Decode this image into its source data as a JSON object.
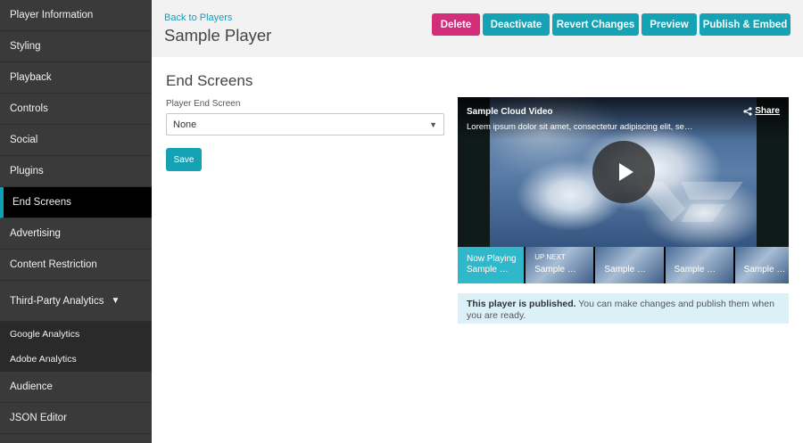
{
  "sidebar": {
    "items": [
      {
        "label": "Player Information"
      },
      {
        "label": "Styling"
      },
      {
        "label": "Playback"
      },
      {
        "label": "Controls"
      },
      {
        "label": "Social"
      },
      {
        "label": "Plugins"
      },
      {
        "label": "End Screens"
      },
      {
        "label": "Advertising"
      },
      {
        "label": "Content Restriction"
      },
      {
        "label": "Third-Party Analytics"
      },
      {
        "label": "Audience"
      },
      {
        "label": "JSON Editor"
      }
    ],
    "active": "End Screens",
    "sub_items": [
      {
        "label": "Google Analytics"
      },
      {
        "label": "Adobe Analytics"
      }
    ],
    "caret": "▼"
  },
  "header": {
    "back_link": "Back to Players",
    "title": "Sample Player",
    "buttons": {
      "delete": "Delete",
      "deactivate": "Deactivate",
      "revert": "Revert Changes",
      "preview": "Preview",
      "publish": "Publish & Embed"
    }
  },
  "main": {
    "section_title": "End Screens",
    "field_label": "Player End Screen",
    "select_value": "None",
    "save_label": "Save"
  },
  "player": {
    "video_title": "Sample Cloud Video",
    "video_desc": "Lorem ipsum dolor sit amet, consectetur adipiscing elit, se…",
    "share_label": "Share",
    "thumbnails": [
      {
        "top": "",
        "label": "Now Playing\nSample …"
      },
      {
        "top": "UP NEXT",
        "label": "Sample …"
      },
      {
        "top": "",
        "label": "Sample …"
      },
      {
        "top": "",
        "label": "Sample …"
      },
      {
        "top": "",
        "label": "Sample …"
      }
    ]
  },
  "notice": {
    "bold": "This player is published.",
    "text": " You can make changes and publish them when you are ready."
  },
  "colors": {
    "accent": "#14a2b4",
    "delete": "#d22e7a",
    "sidebar_bg": "#3a3a3a",
    "notice_bg": "#dcf0f8"
  }
}
